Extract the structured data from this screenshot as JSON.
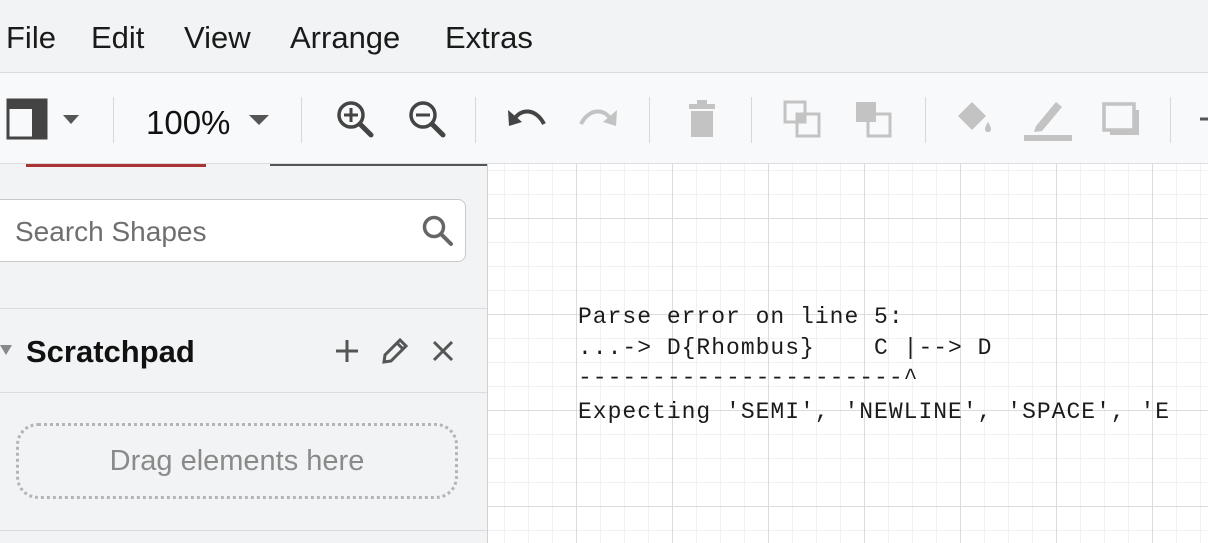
{
  "menubar": {
    "items": [
      {
        "label": "File"
      },
      {
        "label": "Edit"
      },
      {
        "label": "View"
      },
      {
        "label": "Arrange"
      },
      {
        "label": "Extras"
      }
    ]
  },
  "toolbar": {
    "zoom": "100%",
    "buttons": [
      {
        "icon": "format-panel-icon"
      },
      {
        "icon": "zoom-in-icon"
      },
      {
        "icon": "zoom-out-icon"
      },
      {
        "icon": "undo-icon"
      },
      {
        "icon": "redo-icon"
      },
      {
        "icon": "delete-icon"
      },
      {
        "icon": "to-front-icon"
      },
      {
        "icon": "to-back-icon"
      },
      {
        "icon": "fill-color-icon"
      },
      {
        "icon": "line-color-icon"
      },
      {
        "icon": "shadow-icon"
      }
    ]
  },
  "sidebar": {
    "search": {
      "placeholder": "Search Shapes",
      "value": ""
    },
    "scratchpad": {
      "title": "Scratchpad",
      "drop_hint": "Drag elements here"
    }
  },
  "canvas": {
    "error_lines": [
      "Parse error on line 5:",
      "...-> D{Rhombus}    C |--> D",
      "----------------------^",
      "Expecting 'SEMI', 'NEWLINE', 'SPACE', 'E"
    ]
  },
  "colors": {
    "chrome": "#f1f3f4",
    "toolbar": "#f8f9fa",
    "icon_active": "#444444",
    "icon_disabled": "#c3c3c3",
    "grid": "#dcdcdc"
  }
}
